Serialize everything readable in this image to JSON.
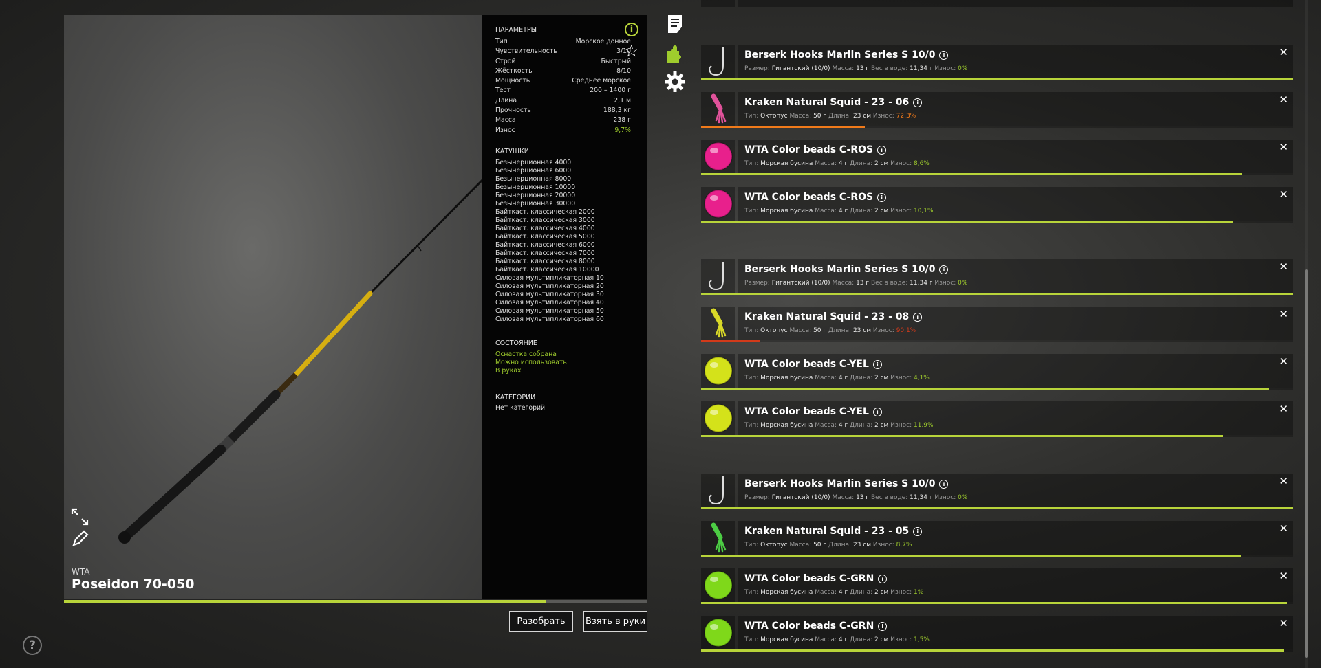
{
  "rod": {
    "brand": "WTA",
    "name": "Poseidon 70-050",
    "condition_fraction": 0.826
  },
  "params": {
    "title": "ПАРАМЕТРЫ",
    "rows": [
      {
        "label": "Тип",
        "value": "Морское донное"
      },
      {
        "label": "Чувствительность",
        "value": "3/10"
      },
      {
        "label": "Строй",
        "value": "Быстрый"
      },
      {
        "label": "Жёсткость",
        "value": "8/10"
      },
      {
        "label": "Мощность",
        "value": "Среднее морское"
      },
      {
        "label": "Тест",
        "value": "200 – 1400 г"
      },
      {
        "label": "Длина",
        "value": "2,1 м"
      },
      {
        "label": "Прочность",
        "value": "188,3 кг"
      },
      {
        "label": "Масса",
        "value": "238 г"
      },
      {
        "label": "Износ",
        "value": "9,7%",
        "accent": true
      }
    ]
  },
  "reels": {
    "title": "КАТУШКИ",
    "items": [
      "Безынерционная 4000",
      "Безынерционная 6000",
      "Безынерционная 8000",
      "Безынерционная 10000",
      "Безынерционная 20000",
      "Безынерционная 30000",
      "Байткаст. классическая 2000",
      "Байткаст. классическая 3000",
      "Байткаст. классическая 4000",
      "Байткаст. классическая 5000",
      "Байткаст. классическая 6000",
      "Байткаст. классическая 7000",
      "Байткаст. классическая 8000",
      "Байткаст. классическая 10000",
      "Силовая мультипликаторная 10",
      "Силовая мультипликаторная 20",
      "Силовая мультипликаторная 30",
      "Силовая мультипликаторная 40",
      "Силовая мультипликаторная 50",
      "Силовая мультипликаторная 60"
    ]
  },
  "state": {
    "title": "СОСТОЯНИЕ",
    "items": [
      "Оснастка собрана",
      "Можно использовать",
      "В руках"
    ]
  },
  "categories": {
    "title": "КАТЕГОРИИ",
    "items": [
      "Нет категорий"
    ]
  },
  "buttons": {
    "disassemble": "Разобрать",
    "take": "Взять в руки"
  },
  "help_label": "?",
  "colors": {
    "accent": "#b8d43a",
    "wear_green": "#9fcc2d",
    "wear_orange": "#f07a1a",
    "wear_red": "#d23a1a"
  },
  "tackle": [
    {
      "kind": "hook",
      "name": "Berserk Hooks Marlin Series S 10/0",
      "d": [
        [
          "Размер:",
          "Гигантский (10/0)"
        ],
        [
          "Масса:",
          "13 г"
        ],
        [
          "Вес в воде:",
          "11,34 г"
        ],
        [
          "Износ:",
          "0%"
        ]
      ],
      "wear_level": "green",
      "condition": 1.0,
      "bar_color": "#b8d43a"
    },
    {
      "kind": "squid",
      "name": "Kraken Natural Squid - 23 - 06",
      "d": [
        [
          "Тип:",
          "Октопус"
        ],
        [
          "Масса:",
          "50 г"
        ],
        [
          "Длина:",
          "23 см"
        ],
        [
          "Износ:",
          "72,3%"
        ]
      ],
      "wear_level": "orange",
      "condition": 0.277,
      "bar_color": "#f07a1a",
      "tint": "#e0529a"
    },
    {
      "kind": "bead",
      "name": "WTA Color beads C-ROS",
      "d": [
        [
          "Тип:",
          "Морская бусина"
        ],
        [
          "Масса:",
          "4 г"
        ],
        [
          "Длина:",
          "2 см"
        ],
        [
          "Износ:",
          "8,6%"
        ]
      ],
      "wear_level": "green",
      "condition": 0.914,
      "bar_color": "#b8d43a",
      "tint": "#e8208c"
    },
    {
      "kind": "bead",
      "name": "WTA Color beads C-ROS",
      "d": [
        [
          "Тип:",
          "Морская бусина"
        ],
        [
          "Масса:",
          "4 г"
        ],
        [
          "Длина:",
          "2 см"
        ],
        [
          "Износ:",
          "10,1%"
        ]
      ],
      "wear_level": "green",
      "condition": 0.899,
      "bar_color": "#b8d43a",
      "tint": "#e8208c"
    },
    {
      "kind": "hook",
      "name": "Berserk Hooks Marlin Series S 10/0",
      "d": [
        [
          "Размер:",
          "Гигантский (10/0)"
        ],
        [
          "Масса:",
          "13 г"
        ],
        [
          "Вес в воде:",
          "11,34 г"
        ],
        [
          "Износ:",
          "0%"
        ]
      ],
      "wear_level": "green",
      "condition": 1.0,
      "bar_color": "#b8d43a"
    },
    {
      "kind": "squid",
      "name": "Kraken Natural Squid - 23 - 08",
      "d": [
        [
          "Тип:",
          "Октопус"
        ],
        [
          "Масса:",
          "50 г"
        ],
        [
          "Длина:",
          "23 см"
        ],
        [
          "Износ:",
          "90,1%"
        ]
      ],
      "wear_level": "red",
      "condition": 0.099,
      "bar_color": "#d23a1a",
      "tint": "#d8d828"
    },
    {
      "kind": "bead",
      "name": "WTA Color beads C-YEL",
      "d": [
        [
          "Тип:",
          "Морская бусина"
        ],
        [
          "Масса:",
          "4 г"
        ],
        [
          "Длина:",
          "2 см"
        ],
        [
          "Износ:",
          "4,1%"
        ]
      ],
      "wear_level": "green",
      "condition": 0.959,
      "bar_color": "#b8d43a",
      "tint": "#d4e21a"
    },
    {
      "kind": "bead",
      "name": "WTA Color beads C-YEL",
      "d": [
        [
          "Тип:",
          "Морская бусина"
        ],
        [
          "Масса:",
          "4 г"
        ],
        [
          "Длина:",
          "2 см"
        ],
        [
          "Износ:",
          "11,9%"
        ]
      ],
      "wear_level": "green",
      "condition": 0.881,
      "bar_color": "#b8d43a",
      "tint": "#d4e21a"
    },
    {
      "kind": "hook",
      "name": "Berserk Hooks Marlin Series S 10/0",
      "d": [
        [
          "Размер:",
          "Гигантский (10/0)"
        ],
        [
          "Масса:",
          "13 г"
        ],
        [
          "Вес в воде:",
          "11,34 г"
        ],
        [
          "Износ:",
          "0%"
        ]
      ],
      "wear_level": "green",
      "condition": 1.0,
      "bar_color": "#b8d43a"
    },
    {
      "kind": "squid",
      "name": "Kraken Natural Squid - 23 - 05",
      "d": [
        [
          "Тип:",
          "Октопус"
        ],
        [
          "Масса:",
          "50 г"
        ],
        [
          "Длина:",
          "23 см"
        ],
        [
          "Износ:",
          "8,7%"
        ]
      ],
      "wear_level": "green",
      "condition": 0.913,
      "bar_color": "#b8d43a",
      "tint": "#4ccc44"
    },
    {
      "kind": "bead",
      "name": "WTA Color beads C-GRN",
      "d": [
        [
          "Тип:",
          "Морская бусина"
        ],
        [
          "Масса:",
          "4 г"
        ],
        [
          "Длина:",
          "2 см"
        ],
        [
          "Износ:",
          "1%"
        ]
      ],
      "wear_level": "green",
      "condition": 0.99,
      "bar_color": "#b8d43a",
      "tint": "#7fd81a"
    },
    {
      "kind": "bead",
      "name": "WTA Color beads C-GRN",
      "d": [
        [
          "Тип:",
          "Морская бусина"
        ],
        [
          "Масса:",
          "4 г"
        ],
        [
          "Длина:",
          "2 см"
        ],
        [
          "Износ:",
          "1,5%"
        ]
      ],
      "wear_level": "green",
      "condition": 0.985,
      "bar_color": "#b8d43a",
      "tint": "#7fd81a"
    }
  ]
}
